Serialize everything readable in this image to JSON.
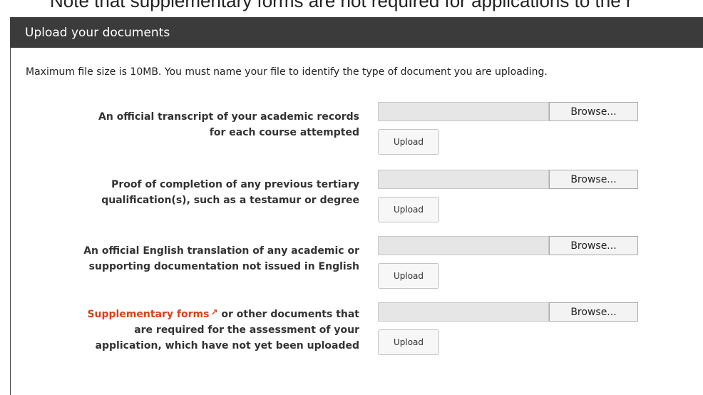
{
  "top_note": "Note that supplementary forms are not required for applications to the r",
  "panel": {
    "title": "Upload your documents",
    "intro": "Maximum file size is 10MB. You must name your file to identify the type of document you are uploading."
  },
  "rows": [
    {
      "label_line1": "An official transcript of your academic records",
      "label_line2": "for each course attempted",
      "browse_label": "Browse...",
      "upload_label": "Upload"
    },
    {
      "label_line1": "Proof of completion of any previous tertiary",
      "label_line2": "qualification(s), such as a testamur or degree",
      "browse_label": "Browse...",
      "upload_label": "Upload"
    },
    {
      "label_line1": "An official English translation of any academic or",
      "label_line2": "supporting documentation not issued in English",
      "browse_label": "Browse...",
      "upload_label": "Upload"
    },
    {
      "link_text": "Supplementary forms",
      "label_line1_rest": " or other documents that",
      "label_line2": "are required for the assessment of your",
      "label_line3": "application, which have not yet been uploaded",
      "browse_label": "Browse...",
      "upload_label": "Upload"
    }
  ],
  "icons": {
    "external_link": "external-link-icon"
  },
  "colors": {
    "header_bg": "#3b3b3b",
    "link": "#d9411e"
  }
}
